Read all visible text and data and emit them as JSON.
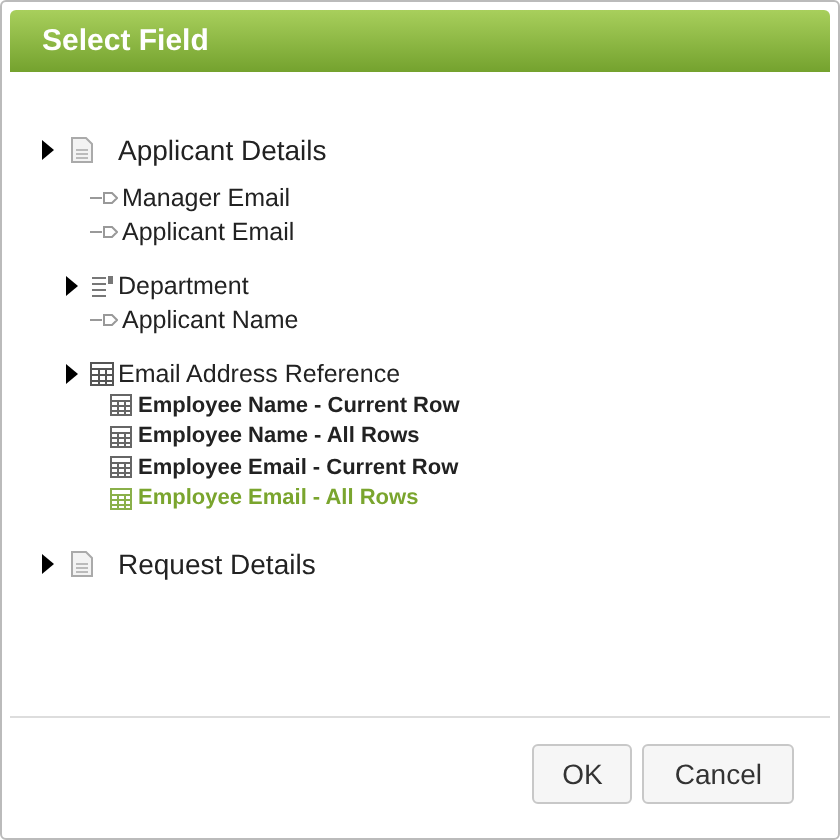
{
  "window": {
    "title": "Select Field"
  },
  "tree": [
    {
      "label": "Applicant Details",
      "kind": "section",
      "children": [
        {
          "label": "Manager Email",
          "kind": "field"
        },
        {
          "label": "Applicant Email",
          "kind": "field"
        },
        {
          "label": "Department",
          "kind": "list"
        },
        {
          "label": "Applicant Name",
          "kind": "field"
        },
        {
          "label": "Email Address Reference",
          "kind": "table",
          "children": [
            {
              "label": "Employee Name - Current Row",
              "kind": "column",
              "selected": false
            },
            {
              "label": "Employee Name - All Rows",
              "kind": "column",
              "selected": false
            },
            {
              "label": "Employee Email - Current Row",
              "kind": "column",
              "selected": false
            },
            {
              "label": "Employee Email - All Rows",
              "kind": "column",
              "selected": true
            }
          ]
        }
      ]
    },
    {
      "label": "Request Details",
      "kind": "section"
    }
  ],
  "buttons": [
    "OK",
    "Cancel"
  ]
}
